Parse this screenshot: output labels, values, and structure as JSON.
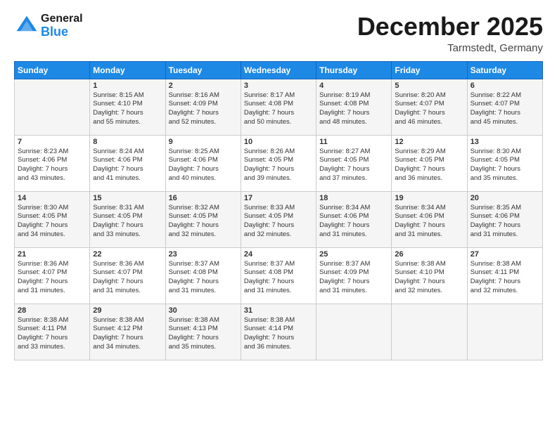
{
  "header": {
    "logo_general": "General",
    "logo_blue": "Blue",
    "title": "December 2025",
    "location": "Tarmstedt, Germany"
  },
  "days_of_week": [
    "Sunday",
    "Monday",
    "Tuesday",
    "Wednesday",
    "Thursday",
    "Friday",
    "Saturday"
  ],
  "weeks": [
    [
      {
        "day": "",
        "info": ""
      },
      {
        "day": "1",
        "info": "Sunrise: 8:15 AM\nSunset: 4:10 PM\nDaylight: 7 hours\nand 55 minutes."
      },
      {
        "day": "2",
        "info": "Sunrise: 8:16 AM\nSunset: 4:09 PM\nDaylight: 7 hours\nand 52 minutes."
      },
      {
        "day": "3",
        "info": "Sunrise: 8:17 AM\nSunset: 4:08 PM\nDaylight: 7 hours\nand 50 minutes."
      },
      {
        "day": "4",
        "info": "Sunrise: 8:19 AM\nSunset: 4:08 PM\nDaylight: 7 hours\nand 48 minutes."
      },
      {
        "day": "5",
        "info": "Sunrise: 8:20 AM\nSunset: 4:07 PM\nDaylight: 7 hours\nand 46 minutes."
      },
      {
        "day": "6",
        "info": "Sunrise: 8:22 AM\nSunset: 4:07 PM\nDaylight: 7 hours\nand 45 minutes."
      }
    ],
    [
      {
        "day": "7",
        "info": "Sunrise: 8:23 AM\nSunset: 4:06 PM\nDaylight: 7 hours\nand 43 minutes."
      },
      {
        "day": "8",
        "info": "Sunrise: 8:24 AM\nSunset: 4:06 PM\nDaylight: 7 hours\nand 41 minutes."
      },
      {
        "day": "9",
        "info": "Sunrise: 8:25 AM\nSunset: 4:06 PM\nDaylight: 7 hours\nand 40 minutes."
      },
      {
        "day": "10",
        "info": "Sunrise: 8:26 AM\nSunset: 4:05 PM\nDaylight: 7 hours\nand 39 minutes."
      },
      {
        "day": "11",
        "info": "Sunrise: 8:27 AM\nSunset: 4:05 PM\nDaylight: 7 hours\nand 37 minutes."
      },
      {
        "day": "12",
        "info": "Sunrise: 8:29 AM\nSunset: 4:05 PM\nDaylight: 7 hours\nand 36 minutes."
      },
      {
        "day": "13",
        "info": "Sunrise: 8:30 AM\nSunset: 4:05 PM\nDaylight: 7 hours\nand 35 minutes."
      }
    ],
    [
      {
        "day": "14",
        "info": "Sunrise: 8:30 AM\nSunset: 4:05 PM\nDaylight: 7 hours\nand 34 minutes."
      },
      {
        "day": "15",
        "info": "Sunrise: 8:31 AM\nSunset: 4:05 PM\nDaylight: 7 hours\nand 33 minutes."
      },
      {
        "day": "16",
        "info": "Sunrise: 8:32 AM\nSunset: 4:05 PM\nDaylight: 7 hours\nand 32 minutes."
      },
      {
        "day": "17",
        "info": "Sunrise: 8:33 AM\nSunset: 4:05 PM\nDaylight: 7 hours\nand 32 minutes."
      },
      {
        "day": "18",
        "info": "Sunrise: 8:34 AM\nSunset: 4:06 PM\nDaylight: 7 hours\nand 31 minutes."
      },
      {
        "day": "19",
        "info": "Sunrise: 8:34 AM\nSunset: 4:06 PM\nDaylight: 7 hours\nand 31 minutes."
      },
      {
        "day": "20",
        "info": "Sunrise: 8:35 AM\nSunset: 4:06 PM\nDaylight: 7 hours\nand 31 minutes."
      }
    ],
    [
      {
        "day": "21",
        "info": "Sunrise: 8:36 AM\nSunset: 4:07 PM\nDaylight: 7 hours\nand 31 minutes."
      },
      {
        "day": "22",
        "info": "Sunrise: 8:36 AM\nSunset: 4:07 PM\nDaylight: 7 hours\nand 31 minutes."
      },
      {
        "day": "23",
        "info": "Sunrise: 8:37 AM\nSunset: 4:08 PM\nDaylight: 7 hours\nand 31 minutes."
      },
      {
        "day": "24",
        "info": "Sunrise: 8:37 AM\nSunset: 4:08 PM\nDaylight: 7 hours\nand 31 minutes."
      },
      {
        "day": "25",
        "info": "Sunrise: 8:37 AM\nSunset: 4:09 PM\nDaylight: 7 hours\nand 31 minutes."
      },
      {
        "day": "26",
        "info": "Sunrise: 8:38 AM\nSunset: 4:10 PM\nDaylight: 7 hours\nand 32 minutes."
      },
      {
        "day": "27",
        "info": "Sunrise: 8:38 AM\nSunset: 4:11 PM\nDaylight: 7 hours\nand 32 minutes."
      }
    ],
    [
      {
        "day": "28",
        "info": "Sunrise: 8:38 AM\nSunset: 4:11 PM\nDaylight: 7 hours\nand 33 minutes."
      },
      {
        "day": "29",
        "info": "Sunrise: 8:38 AM\nSunset: 4:12 PM\nDaylight: 7 hours\nand 34 minutes."
      },
      {
        "day": "30",
        "info": "Sunrise: 8:38 AM\nSunset: 4:13 PM\nDaylight: 7 hours\nand 35 minutes."
      },
      {
        "day": "31",
        "info": "Sunrise: 8:38 AM\nSunset: 4:14 PM\nDaylight: 7 hours\nand 36 minutes."
      },
      {
        "day": "",
        "info": ""
      },
      {
        "day": "",
        "info": ""
      },
      {
        "day": "",
        "info": ""
      }
    ]
  ]
}
